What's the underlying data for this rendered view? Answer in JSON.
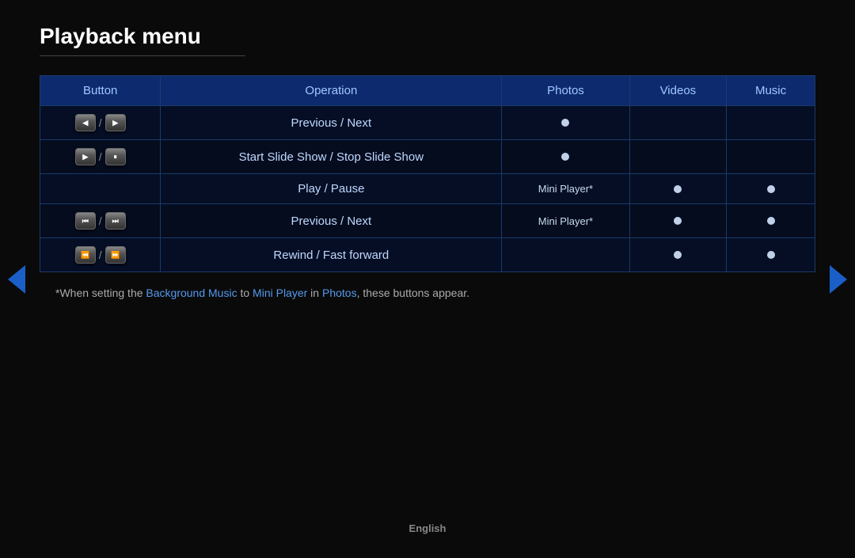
{
  "page": {
    "title": "Playback menu",
    "language": "English"
  },
  "table": {
    "headers": [
      "Button",
      "Operation",
      "Photos",
      "Videos",
      "Music"
    ],
    "rows": [
      {
        "button_icons": [
          {
            "symbol": "◀",
            "type": "prev"
          },
          {
            "symbol": "▶",
            "type": "next"
          }
        ],
        "operation": "Previous / Next",
        "photos": "dot",
        "videos": "",
        "music": ""
      },
      {
        "button_icons": [
          {
            "symbol": "▶",
            "type": "play"
          },
          {
            "symbol": "⏸",
            "type": "pause"
          }
        ],
        "operation": "Start Slide Show / Stop Slide Show",
        "photos": "dot",
        "videos": "",
        "music": ""
      },
      {
        "button_icons": [],
        "operation": "Play / Pause",
        "photos": "Mini Player*",
        "videos": "dot",
        "music": "dot"
      },
      {
        "button_icons": [
          {
            "symbol": "⏮",
            "type": "prev-track"
          },
          {
            "symbol": "⏭",
            "type": "next-track"
          }
        ],
        "operation": "Previous / Next",
        "photos": "Mini Player*",
        "videos": "dot",
        "music": "dot"
      },
      {
        "button_icons": [
          {
            "symbol": "⏪",
            "type": "rewind"
          },
          {
            "symbol": "⏩",
            "type": "fastforward"
          }
        ],
        "operation": "Rewind / Fast forward",
        "photos": "",
        "videos": "dot",
        "music": "dot"
      }
    ]
  },
  "footnote": {
    "text": "*When setting the Background Music to Mini Player in Photos, these buttons appear.",
    "highlight_words": [
      "Background Music",
      "Mini Player",
      "Photos"
    ]
  },
  "nav": {
    "left_label": "previous page",
    "right_label": "next page"
  }
}
